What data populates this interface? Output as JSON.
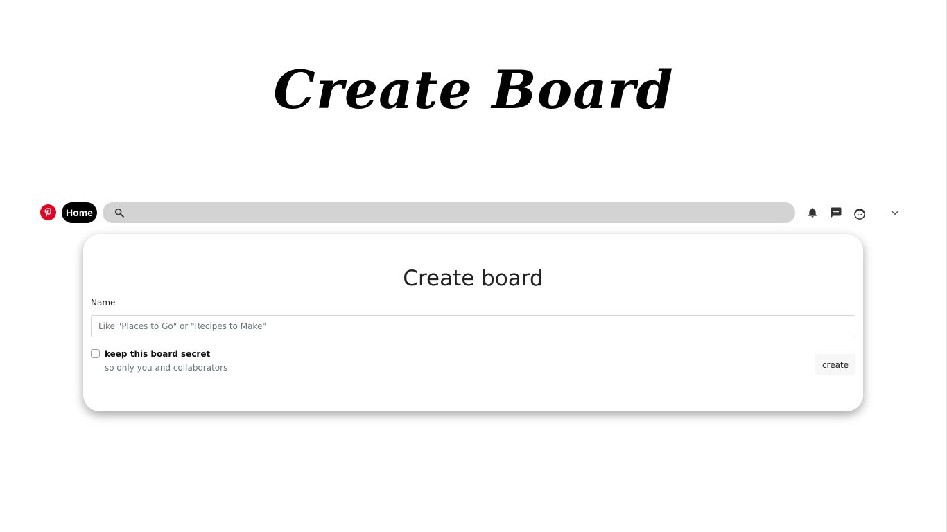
{
  "slide": {
    "title": "Create Board"
  },
  "navbar": {
    "logo_icon": "pinterest-logo-icon",
    "brand_color": "#e60023",
    "home_label": "Home",
    "search": {
      "icon": "search-icon",
      "value": "",
      "placeholder": ""
    },
    "icons": [
      "bell-icon",
      "message-icon",
      "profile-face-icon",
      "chevron-down-icon"
    ]
  },
  "modal": {
    "title": "Create board",
    "name_label": "Name",
    "name_input": {
      "value": "",
      "placeholder": "Like \"Places to Go\" or \"Recipes to Make\""
    },
    "secret": {
      "checked": false,
      "label": "keep this board secret",
      "description": "so only you and collaborators"
    },
    "create_label": "create"
  }
}
